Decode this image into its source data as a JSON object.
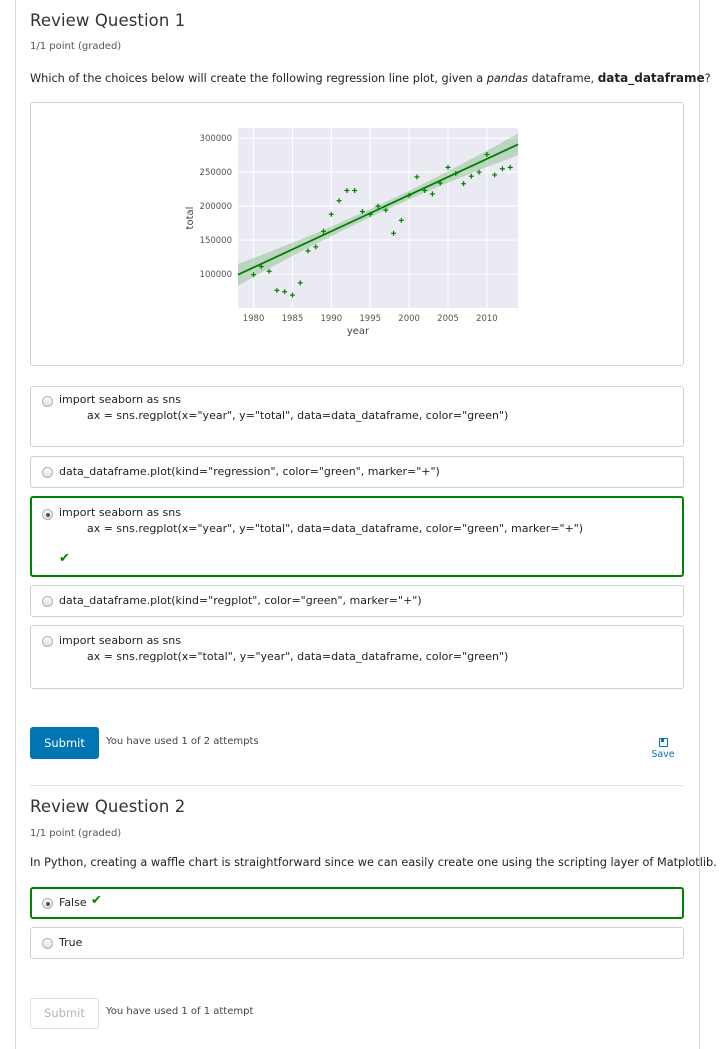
{
  "q1": {
    "title": "Review Question 1",
    "points": "1/1 point (graded)",
    "prompt_pre": "Which of the choices below will create the following regression line plot, given a ",
    "prompt_em": "pandas",
    "prompt_mid": " dataframe, ",
    "prompt_bold": "data_dataframe",
    "prompt_post": "?",
    "choices": [
      {
        "line1": "import seaborn as sns",
        "line2": "        ax = sns.regplot(x=\"year\", y=\"total\", data=data_dataframe, color=\"green\")",
        "selected": false
      },
      {
        "line1": "data_dataframe.plot(kind=\"regression\", color=\"green\", marker=\"+\")",
        "selected": false
      },
      {
        "line1": "import seaborn as sns",
        "line2": "        ax = sns.regplot(x=\"year\", y=\"total\", data=data_dataframe, color=\"green\", marker=\"+\")",
        "selected": true,
        "correct": true
      },
      {
        "line1": "data_dataframe.plot(kind=\"regplot\", color=\"green\", marker=\"+\")",
        "selected": false
      },
      {
        "line1": "import seaborn as sns",
        "line2": "        ax = sns.regplot(x=\"total\", y=\"year\", data=data_dataframe, color=\"green\")",
        "selected": false
      }
    ],
    "submit_label": "Submit",
    "attempts_text": "You have used 1 of 2 attempts",
    "save_label": "Save"
  },
  "q2": {
    "title": "Review Question 2",
    "points": "1/1 point (graded)",
    "prompt": "In Python, creating a waffle chart is straightforward since we can easily create one using the scripting layer of Matplotlib.",
    "choices": [
      {
        "label": "False",
        "selected": true,
        "correct": true
      },
      {
        "label": "True",
        "selected": false
      }
    ],
    "submit_label": "Submit",
    "attempts_text": "You have used 1 of 1 attempt"
  },
  "colors": {
    "accent": "#0075b4",
    "correct": "#008100",
    "plot_bg": "#eaeaf2",
    "series": "#008000"
  },
  "chart_data": {
    "type": "scatter",
    "title": "",
    "xlabel": "year",
    "ylabel": "total",
    "xlim": [
      1978,
      2014
    ],
    "ylim": [
      50000,
      315000
    ],
    "x_ticks": [
      1980,
      1985,
      1990,
      1995,
      2000,
      2005,
      2010
    ],
    "y_ticks": [
      100000,
      150000,
      200000,
      250000,
      300000
    ],
    "x_tick_labels": [
      "1980",
      "1985",
      "1990",
      "1995",
      "2000",
      "2005",
      "2010"
    ],
    "y_tick_labels": [
      "100000",
      "150000",
      "200000",
      "250000",
      "300000"
    ],
    "marker": "+",
    "color": "#008000",
    "points": [
      [
        1980,
        99000
      ],
      [
        1981,
        111000
      ],
      [
        1982,
        104000
      ],
      [
        1983,
        76000
      ],
      [
        1984,
        74000
      ],
      [
        1985,
        69000
      ],
      [
        1986,
        87000
      ],
      [
        1987,
        134000
      ],
      [
        1988,
        140000
      ],
      [
        1989,
        163000
      ],
      [
        1990,
        188000
      ],
      [
        1991,
        208000
      ],
      [
        1992,
        223000
      ],
      [
        1993,
        223000
      ],
      [
        1994,
        192000
      ],
      [
        1995,
        188000
      ],
      [
        1996,
        200000
      ],
      [
        1997,
        194000
      ],
      [
        1998,
        160000
      ],
      [
        1999,
        179000
      ],
      [
        2000,
        216000
      ],
      [
        2001,
        243000
      ],
      [
        2002,
        223000
      ],
      [
        2003,
        218000
      ],
      [
        2004,
        234000
      ],
      [
        2005,
        257000
      ],
      [
        2006,
        248000
      ],
      [
        2007,
        233000
      ],
      [
        2008,
        244000
      ],
      [
        2009,
        250000
      ],
      [
        2010,
        276000
      ],
      [
        2011,
        246000
      ],
      [
        2012,
        255000
      ],
      [
        2013,
        257000
      ]
    ],
    "regression": {
      "intercept_at_1978": 99000,
      "slope_per_year": 5330
    },
    "ci_halfwidth_ends": 16000,
    "ci_halfwidth_mid": 6000
  }
}
